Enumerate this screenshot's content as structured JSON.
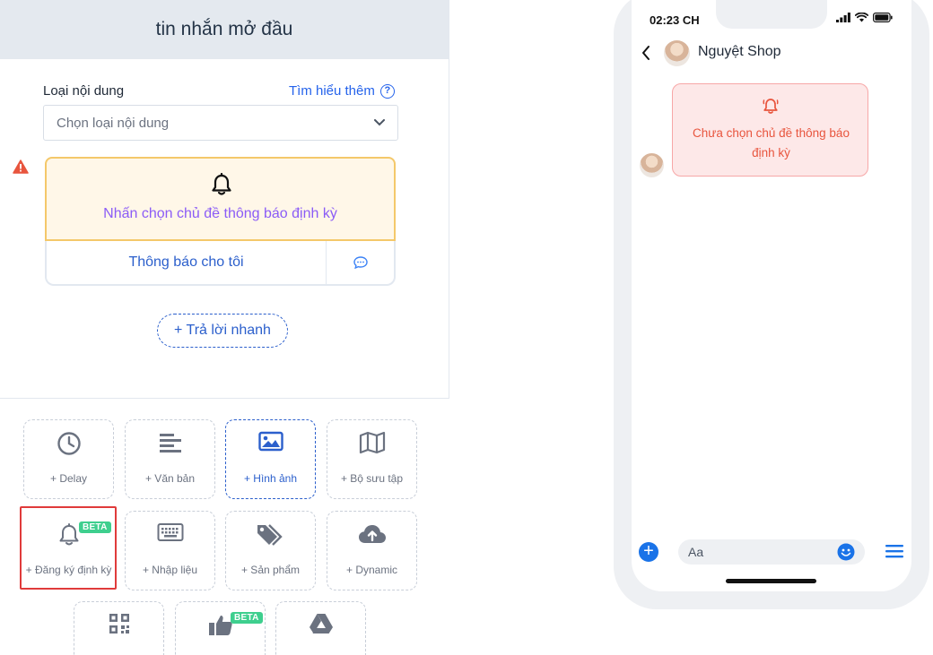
{
  "editor": {
    "title": "tin nhắn mở đầu",
    "content_type_label": "Loại nội dung",
    "learn_more": "Tìm hiểu thêm",
    "select_placeholder": "Chọn loại nội dung",
    "topic_prompt": "Nhấn chọn chủ đề thông báo định kỳ",
    "notify_button": "Thông báo cho tôi",
    "quick_reply": "+ Trả lời nhanh"
  },
  "tiles": [
    {
      "label": "+ Delay",
      "icon": "clock-icon"
    },
    {
      "label": "+ Văn bản",
      "icon": "text-lines-icon"
    },
    {
      "label": "+ Hình ảnh",
      "icon": "image-icon",
      "active": true
    },
    {
      "label": "+ Bộ sưu tập",
      "icon": "map-icon"
    },
    {
      "label": "+ Đăng ký định kỳ",
      "icon": "bell-icon",
      "badge": "BETA",
      "highlighted": true
    },
    {
      "label": "+ Nhập liệu",
      "icon": "keyboard-icon"
    },
    {
      "label": "+ Sản phẩm",
      "icon": "tags-icon"
    },
    {
      "label": "+ Dynamic",
      "icon": "cloud-upload-icon"
    },
    {
      "icon": "qr-code-icon"
    },
    {
      "icon": "thumbs-up-icon",
      "badge": "BETA"
    },
    {
      "icon": "google-drive-icon"
    }
  ],
  "phone": {
    "time": "02:23 CH",
    "shop_name": "Nguyệt Shop",
    "bubble_text": "Chưa chọn chủ đề thông báo định kỳ",
    "input_placeholder": "Aa"
  },
  "colors": {
    "accent": "#2b5fcc",
    "warning": "#e8553e",
    "beta": "#3ecf8e",
    "highlight": "#e03b3b"
  }
}
